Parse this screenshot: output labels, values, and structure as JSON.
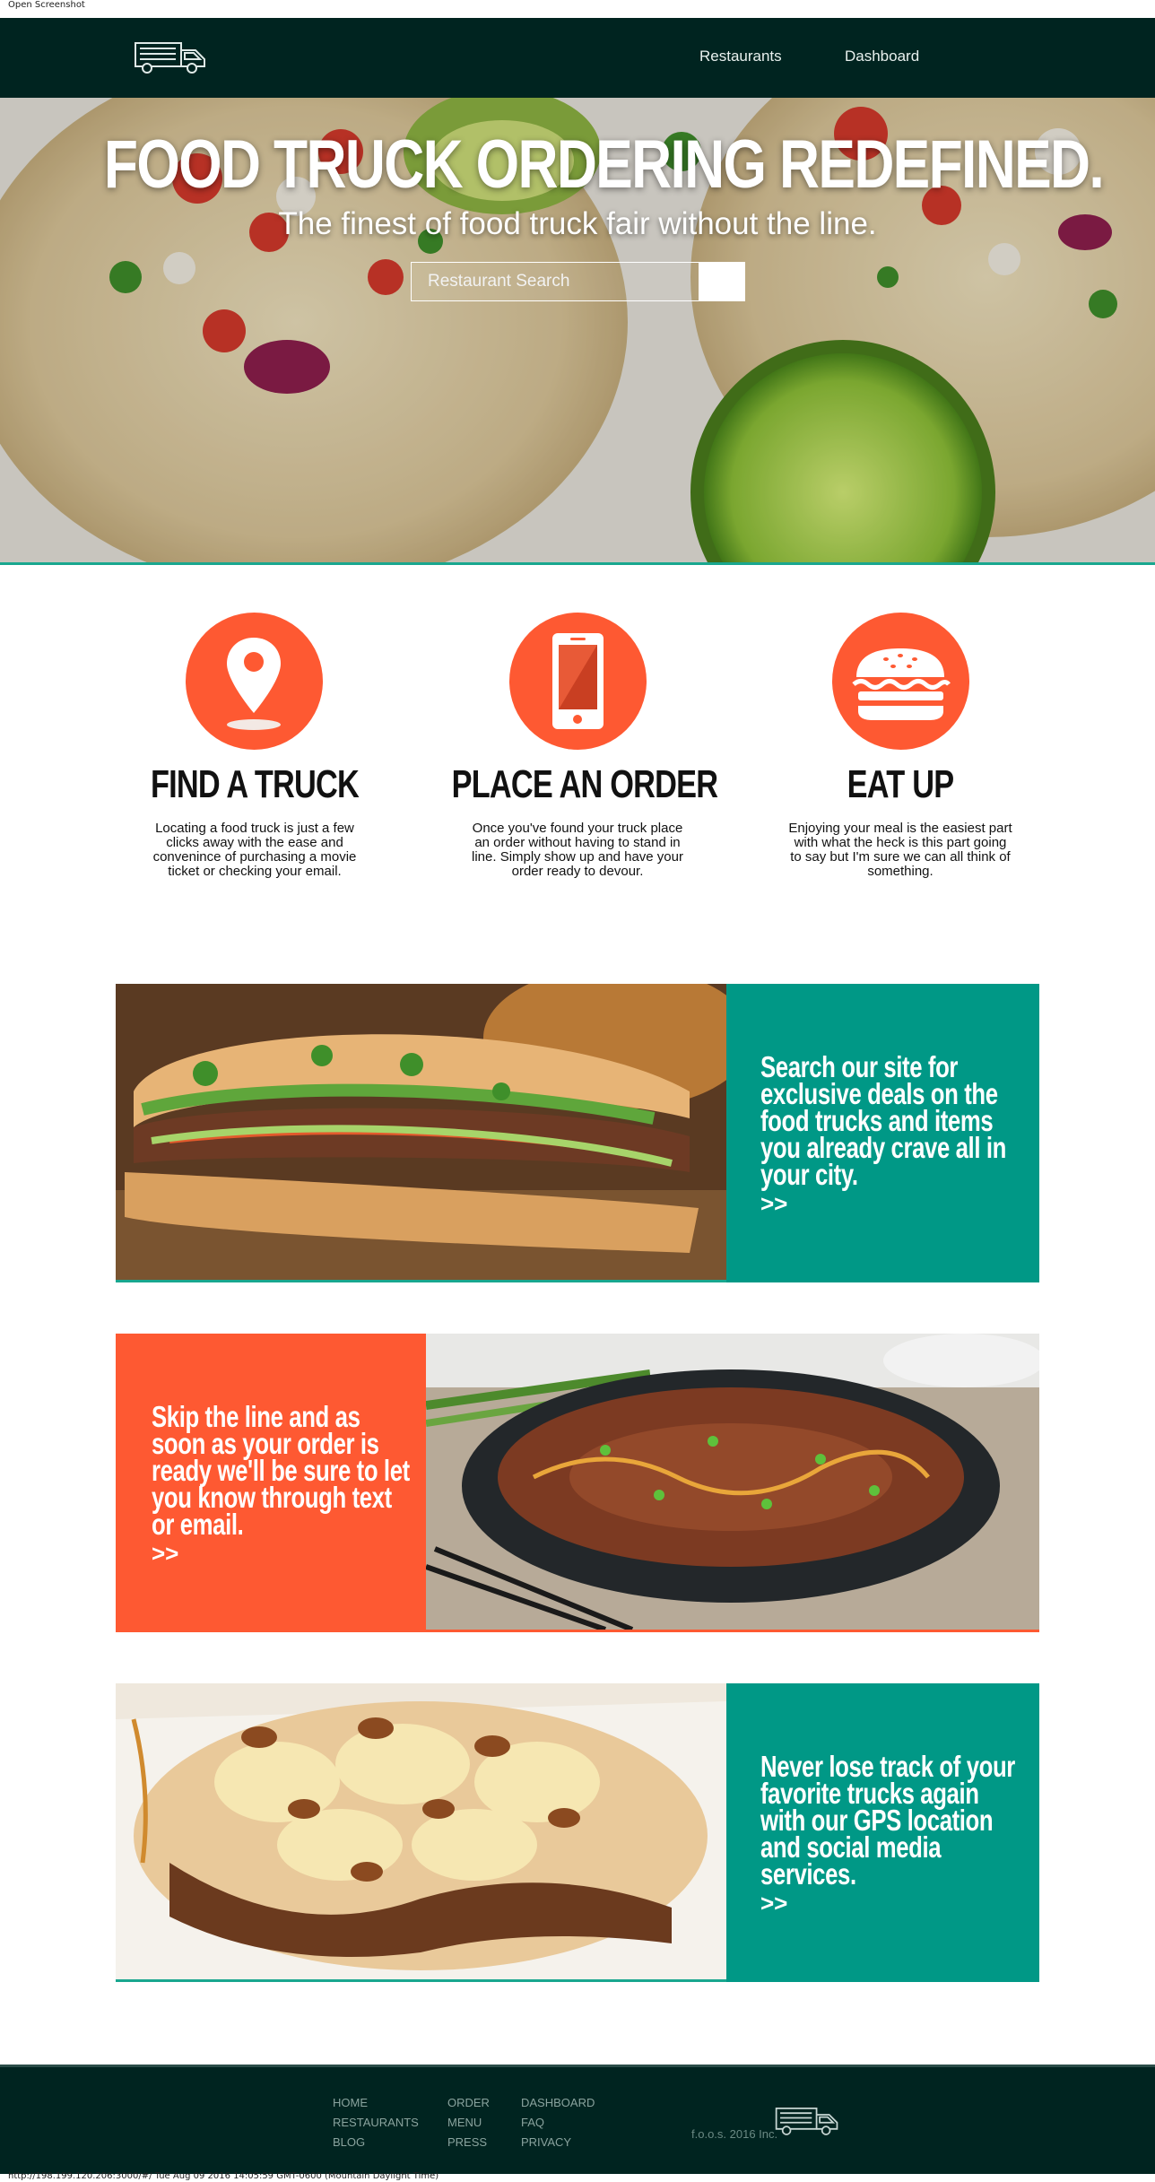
{
  "browser": {
    "top_caption": "Open Screenshot",
    "bottom_caption": "http://198.199.120.206:3000/#/ Tue Aug 09 2016 14:05:59 GMT-0600 (Mountain Daylight Time)"
  },
  "nav": {
    "logo_icon": "food-truck-icon",
    "links": [
      "Restaurants",
      "Dashboard"
    ]
  },
  "hero": {
    "title": "FOOD TRUCK ORDERING REDEFINED.",
    "subtitle": "The finest of food truck fair without the line.",
    "search_placeholder": "Restaurant Search"
  },
  "features": [
    {
      "icon": "map-pin-icon",
      "title": "FIND A TRUCK",
      "description": "Locating a food truck is just a few clicks away with the ease and convenince of purchasing a movie ticket or checking your email."
    },
    {
      "icon": "smartphone-icon",
      "title": "PLACE AN ORDER",
      "description": "Once you've found your truck place an order without having to stand in line. Simply show up and have your order ready to devour."
    },
    {
      "icon": "burger-icon",
      "title": "EAT UP",
      "description": "Enjoying your meal is the easiest part with what the heck is this part going to say but I'm sure we can all think of something."
    }
  ],
  "cards": [
    {
      "text": "Search our site for exclusive deals on the food trucks and items you already crave all in your city.",
      "arrow": ">>"
    },
    {
      "text": "Skip the line and as soon as your order is ready we'll be sure to let you know through text or email.",
      "arrow": ">>"
    },
    {
      "text": "Never lose track of your favorite trucks again with our GPS location and social media services.",
      "arrow": ">>"
    }
  ],
  "footer": {
    "col1": [
      "HOME",
      "RESTAURANTS",
      "BLOG"
    ],
    "col2": [
      "ORDER",
      "MENU",
      "PRESS"
    ],
    "col3": [
      "DASHBOARD",
      "FAQ",
      "PRIVACY"
    ],
    "copyright": "f.o.o.s. 2016 Inc."
  },
  "colors": {
    "navbar": "#002420",
    "accent_orange": "#fe5932",
    "accent_teal": "#009886",
    "teal_line": "#19a78f"
  }
}
